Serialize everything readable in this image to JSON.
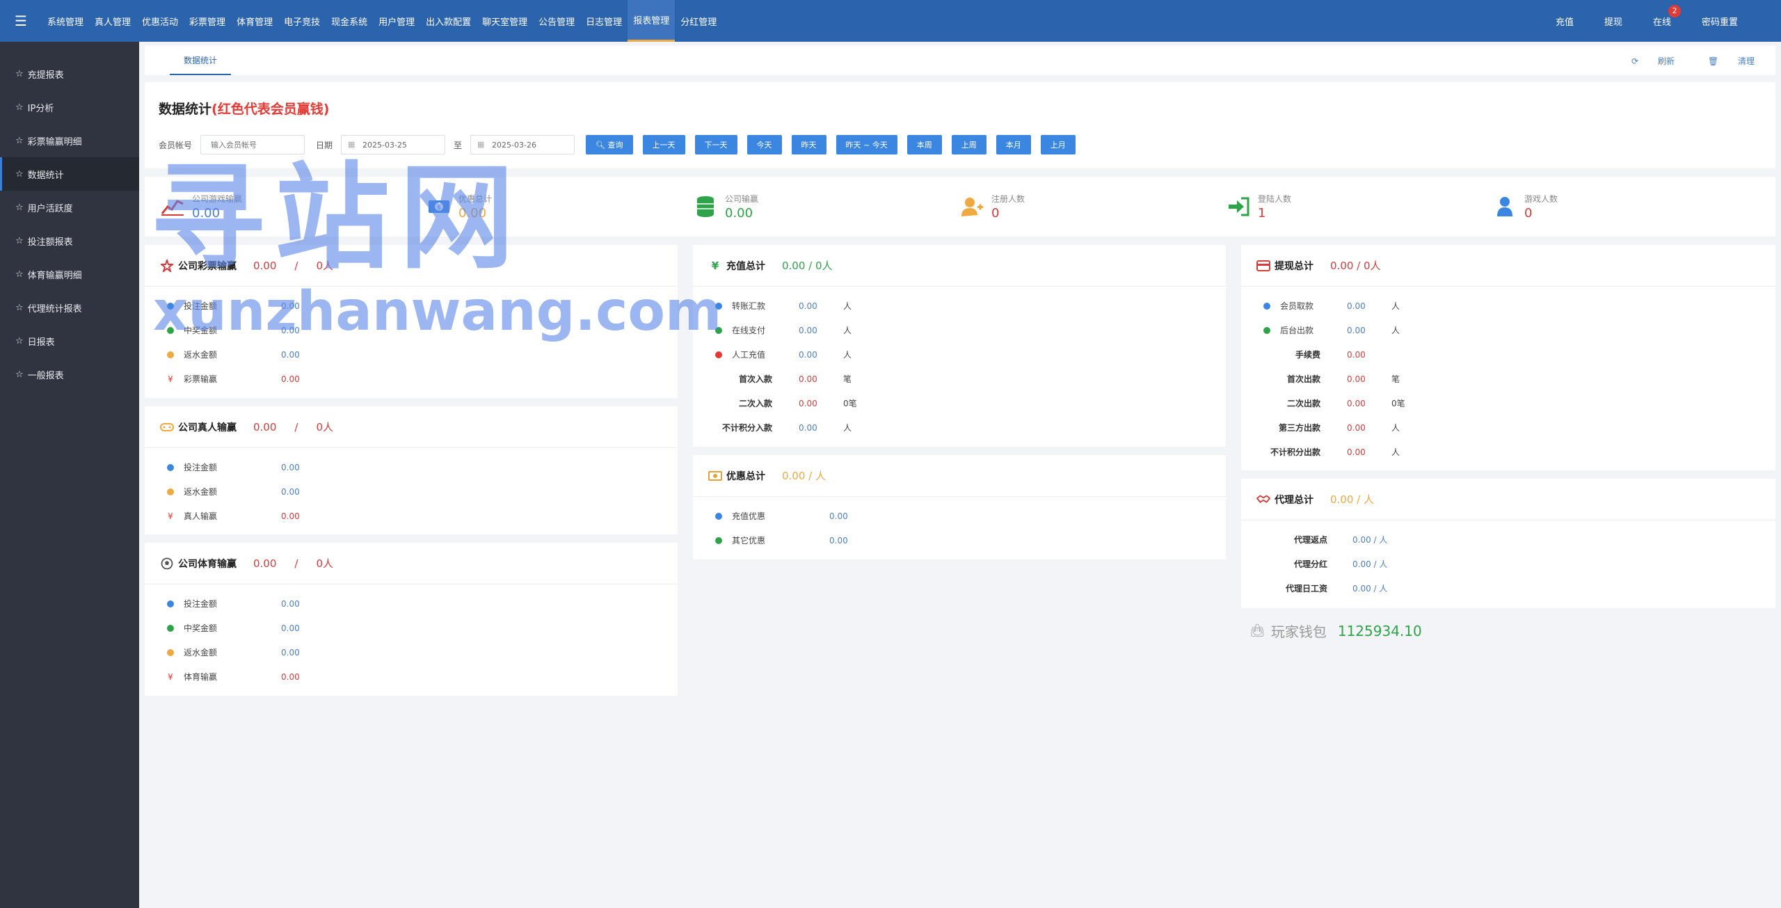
{
  "topnav": {
    "items": [
      "系统管理",
      "真人管理",
      "优惠活动",
      "彩票管理",
      "体育管理",
      "电子竞技",
      "现金系统",
      "用户管理",
      "出入款配置",
      "聊天室管理",
      "公告管理",
      "日志管理",
      "报表管理",
      "分红管理"
    ],
    "active_index": 12,
    "right": {
      "recharge": "充值",
      "withdraw": "提现",
      "online": "在线",
      "online_badge": "2",
      "password_reset": "密码重置"
    }
  },
  "sidebar": {
    "items": [
      "充提报表",
      "IP分析",
      "彩票输赢明细",
      "数据统计",
      "用户活跃度",
      "投注额报表",
      "体育输赢明细",
      "代理统计报表",
      "日报表",
      "一般报表"
    ],
    "active_index": 3
  },
  "tabbar": {
    "tab": "数据统计",
    "refresh": "刷新",
    "clear": "清理"
  },
  "filter": {
    "title": "数据统计",
    "title_note": "(红色代表会员赢钱)",
    "member_label": "会员帐号",
    "member_placeholder": "输入会员帐号",
    "date_label": "日期",
    "date_from": "2025-03-25",
    "to_label": "至",
    "date_to": "2025-03-26",
    "search_btn": "查询",
    "buttons": [
      "上一天",
      "下一天",
      "今天",
      "昨天",
      "昨天 ~ 今天",
      "本周",
      "上周",
      "本月",
      "上月"
    ]
  },
  "stats": [
    {
      "label": "公司游戏输赢",
      "value": "0.00",
      "color": "#4a80c8"
    },
    {
      "label": "优惠总计",
      "value": "0.00",
      "color": "#e8a03a"
    },
    {
      "label": "公司输赢",
      "value": "0.00",
      "color": "#2ea34a"
    },
    {
      "label": "注册人数",
      "value": "0",
      "color": "#e53935"
    },
    {
      "label": "登陆人数",
      "value": "1",
      "color": "#e53935"
    },
    {
      "label": "游戏人数",
      "value": "0",
      "color": "#e53935"
    }
  ],
  "lottery": {
    "title": "公司彩票输赢",
    "total": "0.00",
    "slash": "/",
    "people": "0人",
    "rows": [
      {
        "label": "投注金额",
        "value": "0.00"
      },
      {
        "label": "中奖金额",
        "value": "0.00"
      },
      {
        "label": "返水金额",
        "value": "0.00"
      },
      {
        "label": "彩票输赢",
        "value": "0.00"
      }
    ]
  },
  "live": {
    "title": "公司真人输赢",
    "total": "0.00",
    "slash": "/",
    "people": "0人",
    "rows": [
      {
        "label": "投注金额",
        "value": "0.00"
      },
      {
        "label": "返水金额",
        "value": "0.00"
      },
      {
        "label": "真人输赢",
        "value": "0.00"
      }
    ]
  },
  "sports": {
    "title": "公司体育输赢",
    "total": "0.00",
    "slash": "/",
    "people": "0人",
    "rows": [
      {
        "label": "投注金额",
        "value": "0.00"
      },
      {
        "label": "中奖金额",
        "value": "0.00"
      },
      {
        "label": "返水金额",
        "value": "0.00"
      },
      {
        "label": "体育输赢",
        "value": "0.00"
      }
    ]
  },
  "recharge": {
    "title": "充值总计",
    "summary": "0.00 / 0人",
    "rows": [
      {
        "label": "转账汇款",
        "value": "0.00",
        "unit": "人"
      },
      {
        "label": "在线支付",
        "value": "0.00",
        "unit": "人"
      },
      {
        "label": "人工充值",
        "value": "0.00",
        "unit": "人"
      },
      {
        "label": "首次入款",
        "value": "0.00",
        "unit": "笔"
      },
      {
        "label": "二次入款",
        "value": "0.00",
        "unit": "0笔"
      },
      {
        "label": "不计积分入款",
        "value": "0.00",
        "unit": "人"
      }
    ]
  },
  "promo": {
    "title": "优惠总计",
    "summary": "0.00 / 人",
    "rows": [
      {
        "label": "充值优惠",
        "value": "0.00"
      },
      {
        "label": "其它优惠",
        "value": "0.00"
      }
    ]
  },
  "withdraw": {
    "title": "提现总计",
    "summary": "0.00 / 0人",
    "rows": [
      {
        "label": "会员取款",
        "value": "0.00",
        "unit": "人"
      },
      {
        "label": "后台出款",
        "value": "0.00",
        "unit": "人"
      },
      {
        "label": "手续费",
        "value": "0.00",
        "unit": ""
      },
      {
        "label": "首次出款",
        "value": "0.00",
        "unit": "笔"
      },
      {
        "label": "二次出款",
        "value": "0.00",
        "unit": "0笔"
      },
      {
        "label": "第三方出款",
        "value": "0.00",
        "unit": "人"
      },
      {
        "label": "不计积分出款",
        "value": "0.00",
        "unit": "人"
      }
    ]
  },
  "agent": {
    "title": "代理总计",
    "summary": "0.00 / 人",
    "rows": [
      {
        "label": "代理返点",
        "value": "0.00 / 人"
      },
      {
        "label": "代理分红",
        "value": "0.00 / 人"
      },
      {
        "label": "代理日工资",
        "value": "0.00 / 人"
      }
    ]
  },
  "wallet": {
    "label": "玩家钱包",
    "value": "1125934.10"
  },
  "watermark": {
    "line1": "寻站网",
    "line2": "xunzhanwang.com"
  }
}
